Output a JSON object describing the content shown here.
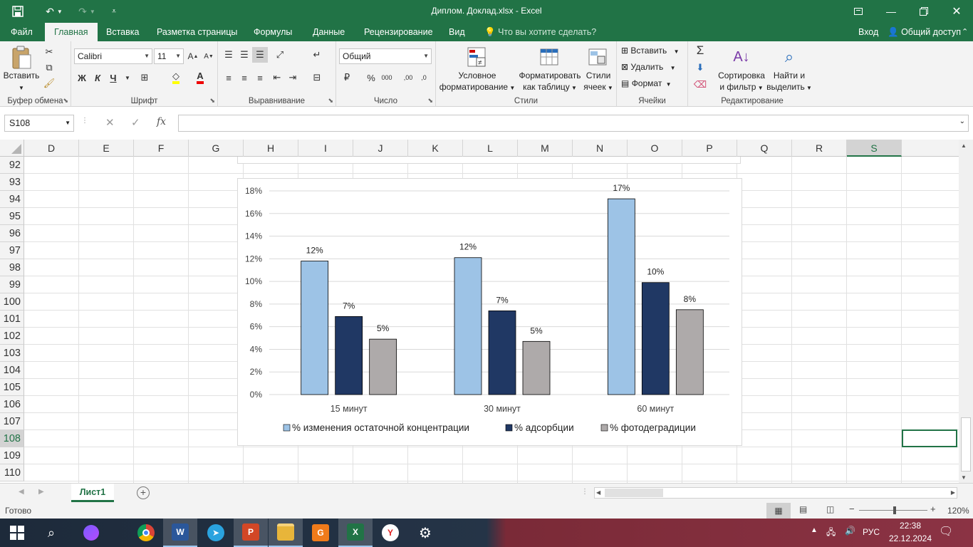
{
  "window": {
    "title": "Диплом. Доклад.xlsx - Excel"
  },
  "tabs": [
    "Файл",
    "Главная",
    "Вставка",
    "Разметка страницы",
    "Формулы",
    "Данные",
    "Рецензирование",
    "Вид"
  ],
  "tell_me": "Что вы хотите сделать?",
  "signin": "Вход",
  "share": "Общий доступ",
  "ribbon": {
    "clipboard": {
      "label": "Буфер обмена",
      "paste": "Вставить"
    },
    "font": {
      "label": "Шрифт",
      "name": "Calibri",
      "size": "11",
      "bold": "Ж",
      "italic": "К",
      "underline": "Ч"
    },
    "alignment": {
      "label": "Выравнивание"
    },
    "number": {
      "label": "Число",
      "format": "Общий"
    },
    "styles": {
      "label": "Стили",
      "cond1": "Условное",
      "cond2": "форматирование",
      "table1": "Форматировать",
      "table2": "как таблицу",
      "cell1": "Стили",
      "cell2": "ячеек"
    },
    "cells": {
      "label": "Ячейки",
      "insert": "Вставить",
      "delete": "Удалить",
      "format": "Формат"
    },
    "editing": {
      "label": "Редактирование",
      "sort1": "Сортировка",
      "sort2": "и фильтр",
      "find1": "Найти и",
      "find2": "выделить"
    }
  },
  "formula_bar": {
    "name_box": "S108",
    "fx": "fx",
    "value": ""
  },
  "columns": [
    "D",
    "E",
    "F",
    "G",
    "H",
    "I",
    "J",
    "K",
    "L",
    "M",
    "N",
    "O",
    "P",
    "Q",
    "R",
    "S"
  ],
  "selected_column": "S",
  "rows": [
    "92",
    "93",
    "94",
    "95",
    "96",
    "97",
    "98",
    "99",
    "100",
    "101",
    "102",
    "103",
    "104",
    "105",
    "106",
    "107",
    "108",
    "109",
    "110"
  ],
  "selected_row": "108",
  "chart_data": {
    "type": "bar",
    "categories": [
      "15 минут",
      "30 минут",
      "60 минут"
    ],
    "series": [
      {
        "name": "% изменения остаточной концентрации",
        "values": [
          0.118,
          0.121,
          0.173
        ],
        "labels": [
          "12%",
          "12%",
          "17%"
        ],
        "color": "#9dc3e6"
      },
      {
        "name": "% адсорбции",
        "values": [
          0.069,
          0.074,
          0.099
        ],
        "labels": [
          "7%",
          "7%",
          "10%"
        ],
        "color": "#203864"
      },
      {
        "name": "% фотодеградиции",
        "values": [
          0.049,
          0.047,
          0.075
        ],
        "labels": [
          "5%",
          "5%",
          "8%"
        ],
        "color": "#aeaaaa"
      }
    ],
    "ylim": [
      0,
      0.18
    ],
    "yticks": [
      "0%",
      "2%",
      "4%",
      "6%",
      "8%",
      "10%",
      "12%",
      "14%",
      "16%",
      "18%"
    ],
    "grid": true,
    "legend": "bottom"
  },
  "sheet_tabs": [
    "Лист1"
  ],
  "status": {
    "ready": "Готово",
    "zoom": "120%"
  },
  "taskbar": {
    "lang": "РУС",
    "time": "22:38",
    "date": "22.12.2024"
  },
  "colors": {
    "excel_green": "#217346"
  }
}
